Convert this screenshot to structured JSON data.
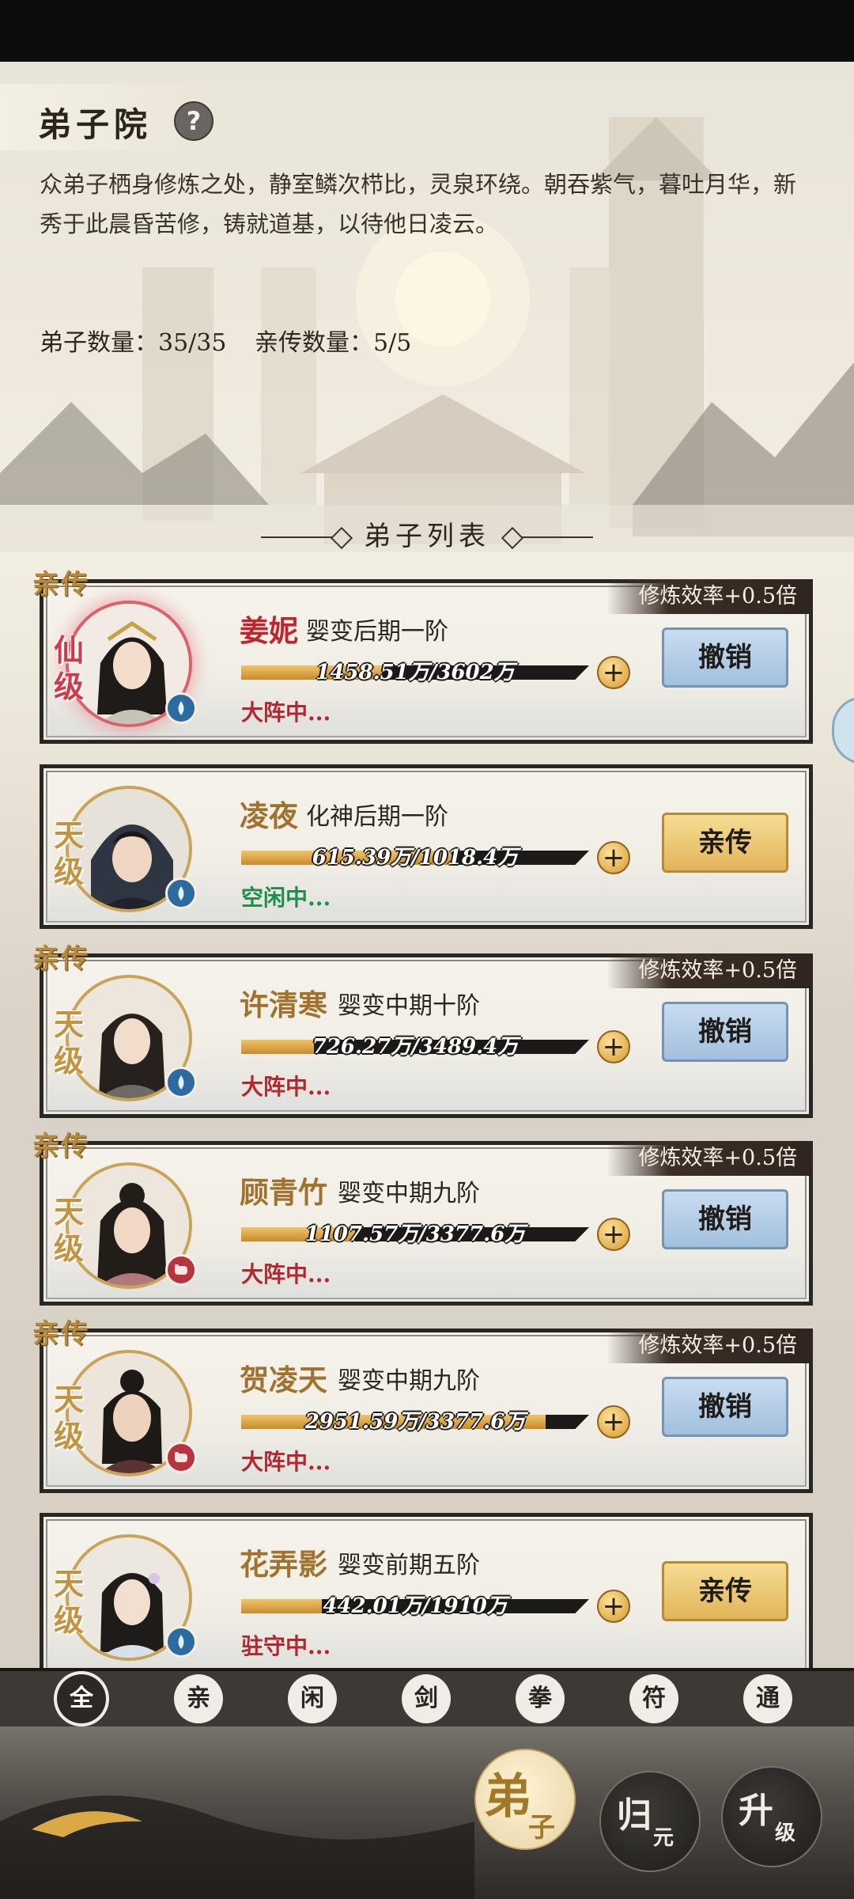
{
  "page": {
    "title": "弟子院",
    "help_icon": "question-mark-icon",
    "description": "众弟子栖身修炼之处，静室鳞次栉比，灵泉环绕。朝吞紫气，暮吐月华，新秀于此晨昏苦修，铸就道基，以待他日凌云。",
    "disciple_count": "弟子数量：35/35",
    "direct_count": "亲传数量：5/5",
    "list_header": "弟子列表"
  },
  "disciples": [
    {
      "name": "姜妮",
      "realm": "婴变后期一阶",
      "progress_text": "1458.51万/3602万",
      "progress": 0.405,
      "status": "大阵中...",
      "grade": "仙级",
      "element_icon": "water-drop-icon",
      "tag": "亲传",
      "bonus": "修炼效率+0.5倍",
      "button": "撤销"
    },
    {
      "name": "凌夜",
      "realm": "化神后期一阶",
      "progress_text": "615.39万/1018.4万",
      "progress": 0.604,
      "status": "空闲中...",
      "grade": "天级",
      "element_icon": "water-drop-icon",
      "tag": "",
      "bonus": "",
      "button": "亲传"
    },
    {
      "name": "许清寒",
      "realm": "婴变中期十阶",
      "progress_text": "726.27万/3489.4万",
      "progress": 0.208,
      "status": "大阵中...",
      "grade": "天级",
      "element_icon": "water-drop-icon",
      "tag": "亲传",
      "bonus": "修炼效率+0.5倍",
      "button": "撤销"
    },
    {
      "name": "顾青竹",
      "realm": "婴变中期九阶",
      "progress_text": "1107.57万/3377.6万",
      "progress": 0.328,
      "status": "大阵中...",
      "grade": "天级",
      "element_icon": "fist-icon",
      "tag": "亲传",
      "bonus": "修炼效率+0.5倍",
      "button": "撤销"
    },
    {
      "name": "贺凌天",
      "realm": "婴变中期九阶",
      "progress_text": "2951.59万/3377.6万",
      "progress": 0.874,
      "status": "大阵中...",
      "grade": "天级",
      "element_icon": "fist-icon",
      "tag": "亲传",
      "bonus": "修炼效率+0.5倍",
      "button": "撤销"
    },
    {
      "name": "花弄影",
      "realm": "婴变前期五阶",
      "progress_text": "442.01万/1910万",
      "progress": 0.231,
      "status": "驻守中...",
      "grade": "天级",
      "element_icon": "water-drop-icon",
      "tag": "",
      "bonus": "",
      "button": "亲传"
    }
  ],
  "filters": [
    "全",
    "亲",
    "闲",
    "剑",
    "拳",
    "符",
    "通"
  ],
  "bottom_nav": [
    {
      "big": "弟",
      "small": "子",
      "active": true
    },
    {
      "big": "归",
      "small": "元",
      "active": false
    },
    {
      "big": "升",
      "small": "级",
      "active": false
    }
  ],
  "colors": {
    "accent_gold": "#c9a458",
    "revoke_blue": "#a2c0de",
    "appoint_gold": "#e2b45a",
    "status_red": "#b3272e",
    "status_green": "#1e8e4c"
  }
}
